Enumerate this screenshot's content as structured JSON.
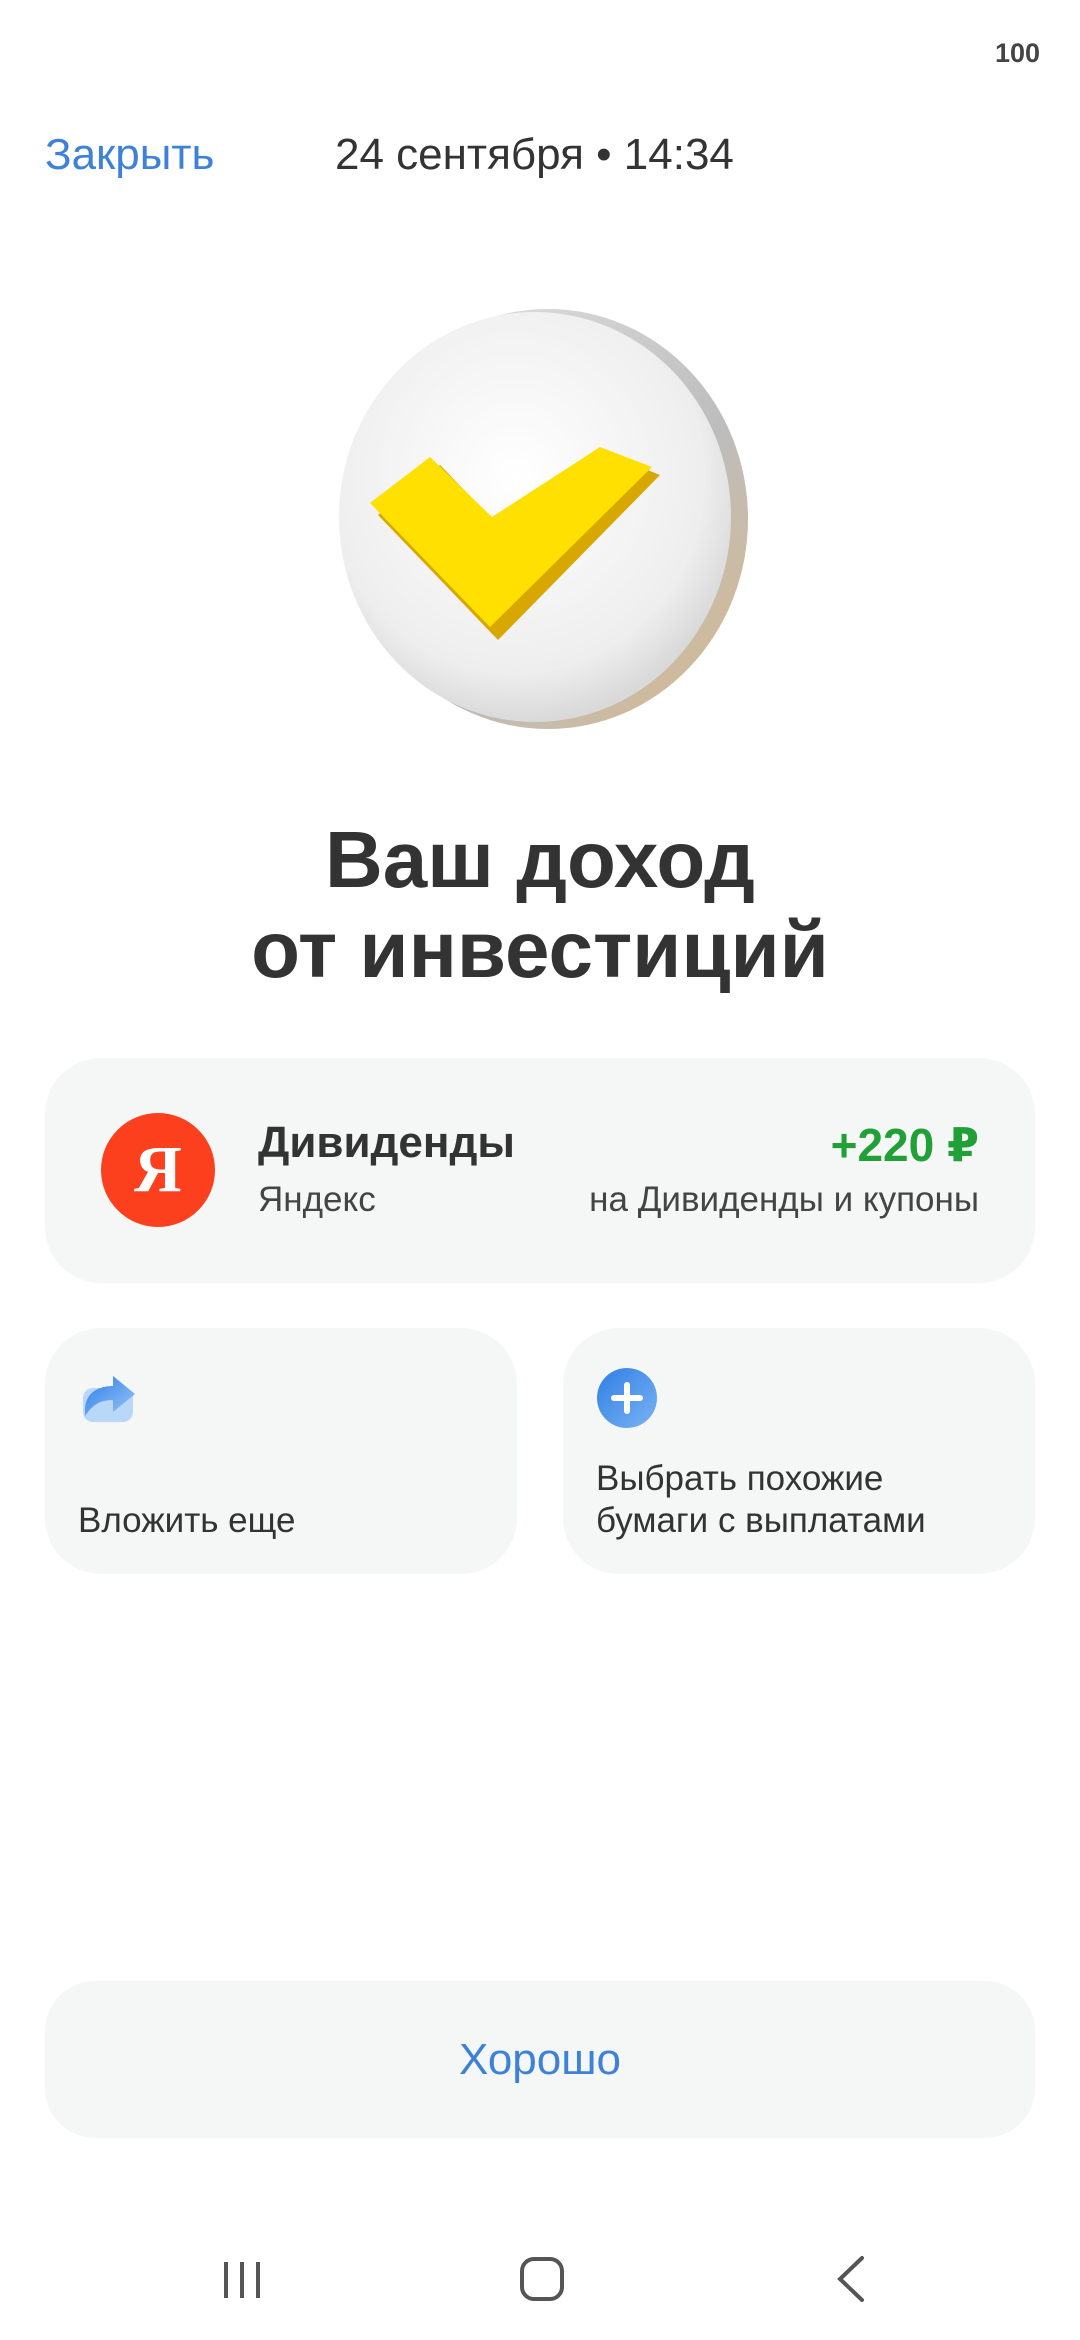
{
  "status_bar": {
    "battery": "100"
  },
  "header": {
    "close_label": "Закрыть",
    "datetime": "24 сентября • 14:34"
  },
  "hero": {
    "icon": "yellow-checkmark-coin-icon"
  },
  "title": {
    "line1": "Ваш доход",
    "line2": "от инвестиций"
  },
  "dividend": {
    "logo_letter": "Я",
    "title": "Дивиденды",
    "company": "Яндекс",
    "amount": "+220 ₽",
    "description": "на Дивиденды и купоны"
  },
  "actions": [
    {
      "icon": "share-arrow-icon",
      "label": "Вложить еще"
    },
    {
      "icon": "plus-circle-icon",
      "label_line1": "Выбрать похожие",
      "label_line2": "бумаги с выплатами"
    }
  ],
  "ok_button": {
    "label": "Хорошо"
  },
  "colors": {
    "accent": "#3d82d8",
    "positive": "#21a038",
    "yandex_red": "#fc3f1d",
    "card_bg": "#f5f6f6"
  }
}
